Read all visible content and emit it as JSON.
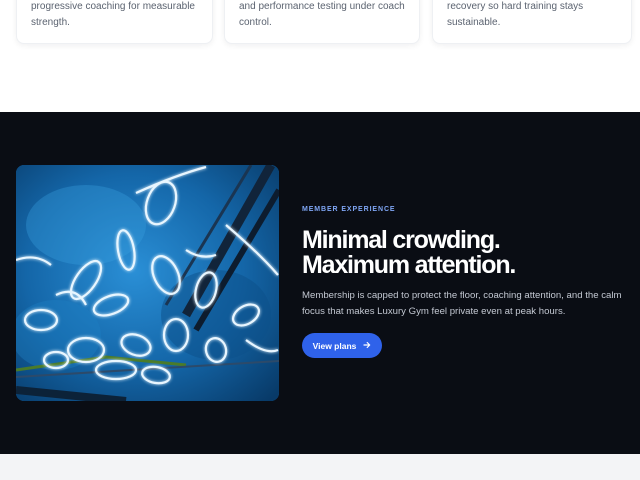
{
  "features": {
    "cards": [
      {
        "text": "progressive coaching for measurable strength."
      },
      {
        "text": "and performance testing under coach control."
      },
      {
        "text": "recovery so hard training stays sustainable."
      }
    ]
  },
  "experience": {
    "eyebrow": "MEMBER EXPERIENCE",
    "headline_line1": "Minimal crowding.",
    "headline_line2": "Maximum attention.",
    "body": "Membership is capped to protect the floor, coaching attention, and the calm focus that makes Luxury Gym feel private even at peak hours.",
    "cta_label": "View plans",
    "cta_icon": "arrow-right-icon",
    "image_subject": "neon-light-installation",
    "colors": {
      "section_bg": "#0a0d14",
      "accent": "#2f62ea",
      "eyebrow": "#7fa6f5"
    }
  }
}
